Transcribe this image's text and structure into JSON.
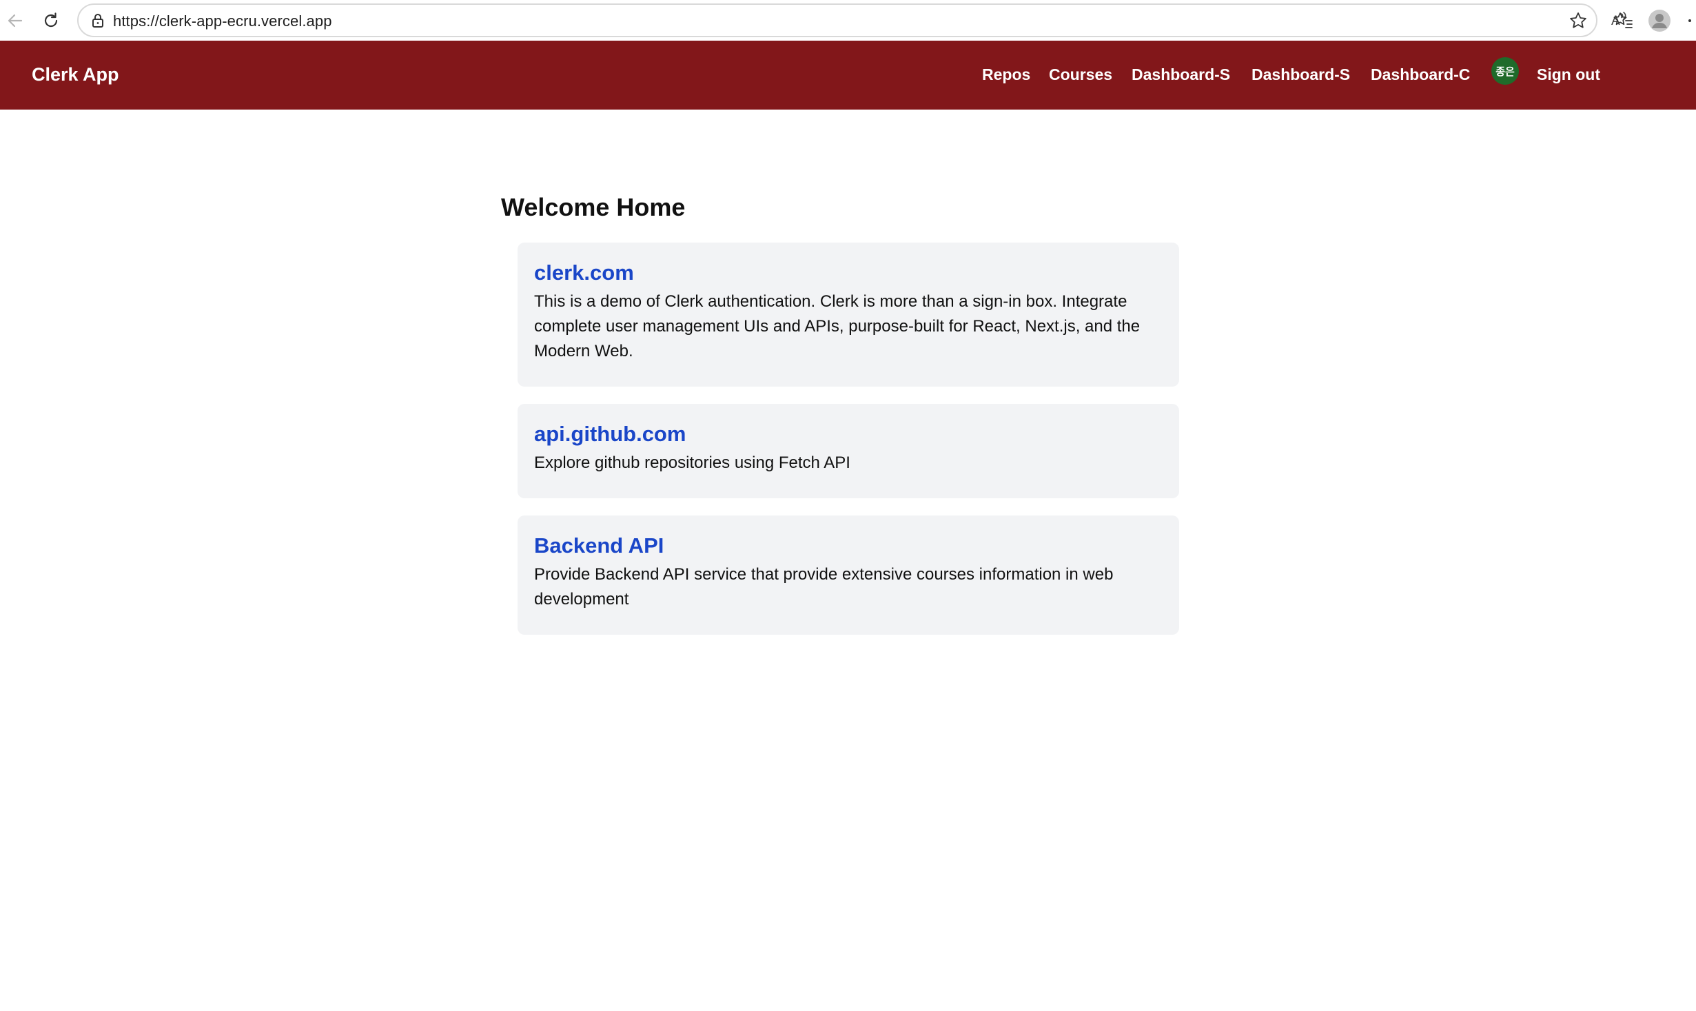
{
  "browser": {
    "url": "https://clerk-app-ecru.vercel.app",
    "icons": [
      "back-icon",
      "reload-icon",
      "lock-icon",
      "read-aloud-icon",
      "favorite-star-icon",
      "favorites-list-icon",
      "profile-icon",
      "more-icon"
    ]
  },
  "header": {
    "brand": "Clerk App",
    "nav": [
      {
        "label": "Repos"
      },
      {
        "label": "Courses"
      },
      {
        "label": "Dashboard-S"
      },
      {
        "label": "Dashboard-S"
      },
      {
        "label": "Dashboard-C"
      }
    ],
    "avatar_text": "종은",
    "sign_out": "Sign out",
    "color": "#82171a"
  },
  "main": {
    "title": "Welcome Home",
    "cards": [
      {
        "title": "clerk.com",
        "description": "This is a demo of Clerk authentication. Clerk is more than a sign-in box. Integrate complete user management UIs and APIs, purpose-built for React, Next.js, and the Modern Web."
      },
      {
        "title": "api.github.com",
        "description": "Explore github repositories using Fetch API"
      },
      {
        "title": "Backend API",
        "description": "Provide Backend API service that provide extensive courses information in web development"
      }
    ]
  }
}
